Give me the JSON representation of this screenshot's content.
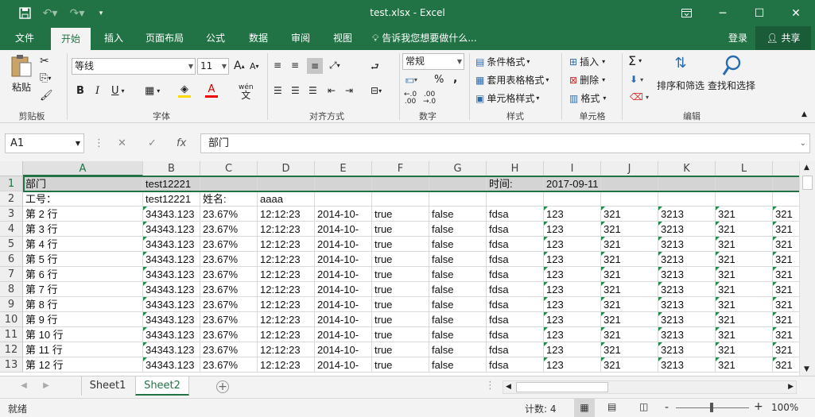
{
  "titlebar": {
    "title": "test.xlsx - Excel",
    "save_icon": "save-icon",
    "minimize": "─",
    "maximize": "☐",
    "close": "✕"
  },
  "ribbon_tabs": [
    "文件",
    "开始",
    "插入",
    "页面布局",
    "公式",
    "数据",
    "审阅",
    "视图"
  ],
  "tell_me": "告诉我您想要做什么...",
  "login": "登录",
  "share": "共享",
  "ribbon": {
    "clipboard": {
      "paste": "粘贴",
      "label": "剪贴板"
    },
    "font": {
      "name": "等线",
      "size": "11",
      "label": "字体",
      "bold": "B",
      "italic": "I",
      "underline": "U",
      "grow": "A",
      "shrink": "A",
      "wen": "wén"
    },
    "alignment": {
      "label": "对齐方式"
    },
    "number": {
      "format": "常规",
      "percent": "%",
      "comma": ",",
      "label": "数字",
      "inc": ".00",
      "dec": ".00"
    },
    "styles": {
      "conditional": "条件格式",
      "table": "套用表格格式",
      "cell": "单元格样式",
      "label": "样式"
    },
    "cells": {
      "insert": "插入",
      "delete": "删除",
      "format": "格式",
      "label": "单元格"
    },
    "editing": {
      "sort": "排序和筛选",
      "find": "查找和选择",
      "label": "编辑",
      "sigma": "Σ"
    }
  },
  "formula_bar": {
    "name_box": "A1",
    "fx": "fx",
    "value": "部门"
  },
  "columns": [
    "A",
    "B",
    "C",
    "D",
    "E",
    "F",
    "G",
    "H",
    "I",
    "J",
    "K",
    "L",
    ""
  ],
  "rows": [
    {
      "n": "1",
      "cells": [
        "部门",
        "test12221",
        "",
        "",
        "",
        "",
        "",
        "时间:",
        "2017-09-11",
        "",
        "",
        "",
        ""
      ]
    },
    {
      "n": "2",
      "cells": [
        "工号：",
        "test12221",
        "姓名:",
        "aaaa",
        "",
        "",
        "",
        "",
        "",
        "",
        "",
        "",
        ""
      ]
    },
    {
      "n": "3",
      "cells": [
        "第 2 行",
        "34343.123",
        "23.67%",
        "12:12:23",
        "2014-10-",
        "true",
        "false",
        "fdsa",
        "123",
        "321",
        "3213",
        "321",
        "321"
      ]
    },
    {
      "n": "4",
      "cells": [
        "第 3 行",
        "34343.123",
        "23.67%",
        "12:12:23",
        "2014-10-",
        "true",
        "false",
        "fdsa",
        "123",
        "321",
        "3213",
        "321",
        "321"
      ]
    },
    {
      "n": "5",
      "cells": [
        "第 4 行",
        "34343.123",
        "23.67%",
        "12:12:23",
        "2014-10-",
        "true",
        "false",
        "fdsa",
        "123",
        "321",
        "3213",
        "321",
        "321"
      ]
    },
    {
      "n": "6",
      "cells": [
        "第 5 行",
        "34343.123",
        "23.67%",
        "12:12:23",
        "2014-10-",
        "true",
        "false",
        "fdsa",
        "123",
        "321",
        "3213",
        "321",
        "321"
      ]
    },
    {
      "n": "7",
      "cells": [
        "第 6 行",
        "34343.123",
        "23.67%",
        "12:12:23",
        "2014-10-",
        "true",
        "false",
        "fdsa",
        "123",
        "321",
        "3213",
        "321",
        "321"
      ]
    },
    {
      "n": "8",
      "cells": [
        "第 7 行",
        "34343.123",
        "23.67%",
        "12:12:23",
        "2014-10-",
        "true",
        "false",
        "fdsa",
        "123",
        "321",
        "3213",
        "321",
        "321"
      ]
    },
    {
      "n": "9",
      "cells": [
        "第 8 行",
        "34343.123",
        "23.67%",
        "12:12:23",
        "2014-10-",
        "true",
        "false",
        "fdsa",
        "123",
        "321",
        "3213",
        "321",
        "321"
      ]
    },
    {
      "n": "10",
      "cells": [
        "第 9 行",
        "34343.123",
        "23.67%",
        "12:12:23",
        "2014-10-",
        "true",
        "false",
        "fdsa",
        "123",
        "321",
        "3213",
        "321",
        "321"
      ]
    },
    {
      "n": "11",
      "cells": [
        "第 10 行",
        "34343.123",
        "23.67%",
        "12:12:23",
        "2014-10-",
        "true",
        "false",
        "fdsa",
        "123",
        "321",
        "3213",
        "321",
        "321"
      ]
    },
    {
      "n": "12",
      "cells": [
        "第 11 行",
        "34343.123",
        "23.67%",
        "12:12:23",
        "2014-10-",
        "true",
        "false",
        "fdsa",
        "123",
        "321",
        "3213",
        "321",
        "321"
      ]
    },
    {
      "n": "13",
      "cells": [
        "第 12 行",
        "34343.123",
        "23.67%",
        "12:12:23",
        "2014-10-",
        "true",
        "false",
        "fdsa",
        "123",
        "321",
        "3213",
        "321",
        "321"
      ]
    }
  ],
  "sheets": [
    "Sheet1",
    "Sheet2"
  ],
  "active_sheet": "Sheet2",
  "add_sheet": "+",
  "status": {
    "ready": "就绪",
    "count": "计数: 4",
    "zoom": "100%",
    "minus": "-",
    "plus": "+"
  },
  "colors": {
    "accent": "#217346",
    "header_gray": "#d4d4d4",
    "text_triangle": "#1e8a4c"
  }
}
